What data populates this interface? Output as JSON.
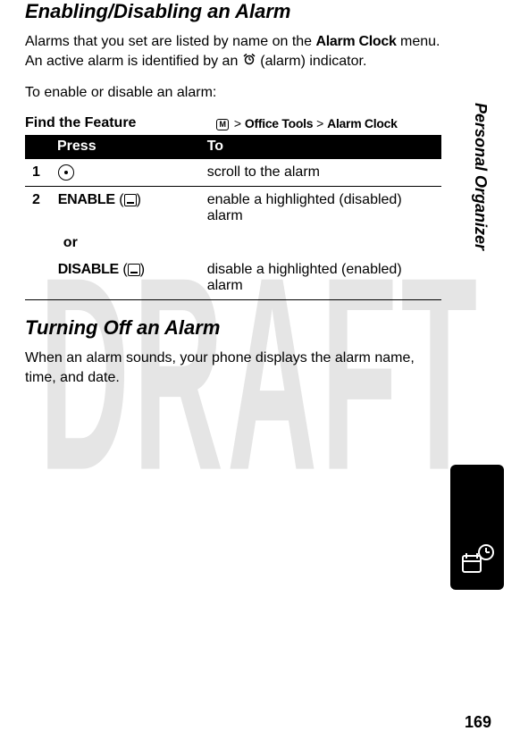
{
  "watermark": "DRAFT",
  "section1_title": "Enabling/Disabling an Alarm",
  "para1_a": "Alarms that you set are listed by name on the ",
  "para1_alarmclock": "Alarm Clock",
  "para1_b": " menu. An active alarm is identified by an ",
  "para1_c": " (alarm) indicator.",
  "para2": "To enable or disable an alarm:",
  "feature_label": "Find the Feature",
  "menu_key_glyph": "M",
  "path_sep1": " > ",
  "path_office": "Office Tools",
  "path_sep2": " > ",
  "path_alarm": "Alarm Clock",
  "th_press": "Press",
  "th_to": "To",
  "row1_num": "1",
  "row1_to": "scroll to the alarm",
  "row2_num": "2",
  "row2_enable": "ENABLE",
  "row2_paren_open": " (",
  "row2_paren_close": ")",
  "row2_to_a": "enable a highlighted (disabled) alarm",
  "row_or": "or",
  "row3_disable": "DISABLE",
  "row3_to": "disable a highlighted (enabled) alarm",
  "section2_title": "Turning Off an Alarm",
  "para3": "When an alarm sounds, your phone displays the alarm name, time, and date.",
  "side_label": "Personal Organizer",
  "page_number": "169"
}
